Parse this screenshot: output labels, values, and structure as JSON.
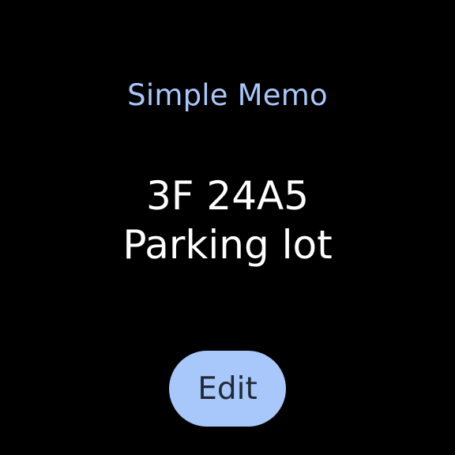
{
  "app": {
    "title": "Simple Memo"
  },
  "memo": {
    "lines": [
      "3F 24A5",
      "Parking lot"
    ]
  },
  "actions": {
    "edit_label": "Edit"
  },
  "colors": {
    "background": "#000000",
    "accent": "#a8c7fa",
    "text": "#ffffff",
    "button_text": "#1f2a37"
  }
}
